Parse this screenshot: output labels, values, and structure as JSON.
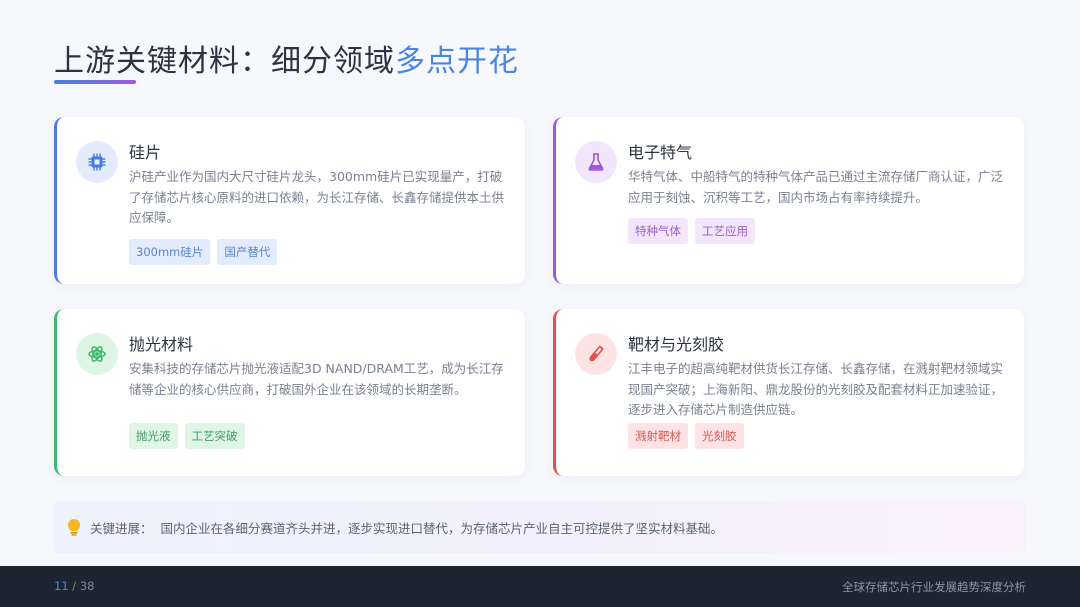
{
  "slide": {
    "title_main": "上游关键材料：细分领域",
    "title_highlight": "多点开花"
  },
  "cards": [
    {
      "title": "硅片",
      "icon": "chip-icon",
      "body": "沪硅产业作为国内大尺寸硅片龙头，300mm硅片已实现量产，打破了存储芯片核心原料的进口依赖，为长江存储、长鑫存储提供本土供应保障。",
      "tags": [
        "300mm硅片",
        "国产替代"
      ],
      "accent": "#4a7be0"
    },
    {
      "title": "电子特气",
      "icon": "flask-icon",
      "body": "华特气体、中船特气的特种气体产品已通过主流存储厂商认证，广泛应用于刻蚀、沉积等工艺，国内市场占有率持续提升。",
      "tags": [
        "特种气体",
        "工艺应用"
      ],
      "accent": "#9b59d6"
    },
    {
      "title": "抛光材料",
      "icon": "atom-icon",
      "body": "安集科技的存储芯片抛光液适配3D NAND/DRAM工艺，成为长江存储等企业的核心供应商，打破国外企业在该领域的长期垄断。",
      "tags": [
        "抛光液",
        "工艺突破"
      ],
      "accent": "#3cb96a"
    },
    {
      "title": "靶材与光刻胶",
      "icon": "test-tube-icon",
      "body": "江丰电子的超高纯靶材供货长江存储、长鑫存储，在溅射靶材领域实现国产突破；上海新阳、鼎龙股份的光刻胶及配套材料正加速验证，逐步进入存储芯片制造供应链。",
      "tags": [
        "溅射靶材",
        "光刻胶"
      ],
      "accent": "#e0524c"
    }
  ],
  "key_progress": {
    "icon": "lightbulb-icon",
    "label": "关键进展：",
    "text": "国内企业在各细分赛道齐头并进，逐步实现进口替代，为存储芯片产业自主可控提供了坚实材料基础。"
  },
  "footer": {
    "current_page": "11",
    "total_pages": "/ 38",
    "doc_title": "全球存储芯片行业发展趋势深度分析"
  }
}
